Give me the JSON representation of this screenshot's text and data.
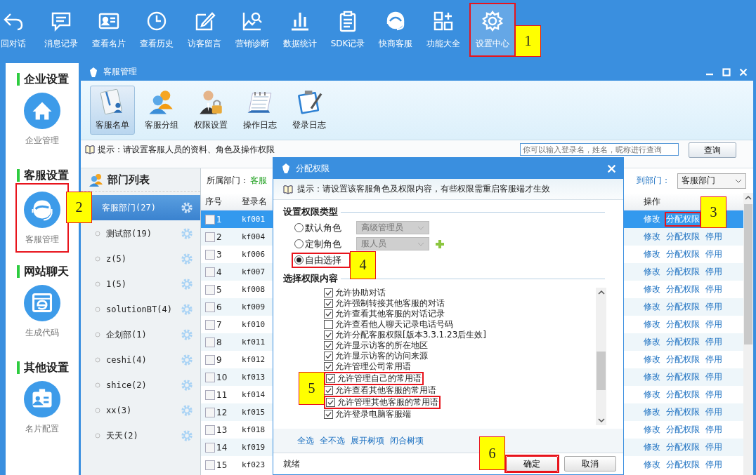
{
  "toolbar": {
    "items": [
      {
        "label": "回对话",
        "selected": false
      },
      {
        "label": "消息记录",
        "selected": false
      },
      {
        "label": "查看名片",
        "selected": false
      },
      {
        "label": "查看历史",
        "selected": false
      },
      {
        "label": "访客留言",
        "selected": false
      },
      {
        "label": "营销诊断",
        "selected": false
      },
      {
        "label": "数据统计",
        "selected": false
      },
      {
        "label": "SDK记录",
        "selected": false
      },
      {
        "label": "快商客服",
        "selected": false
      },
      {
        "label": "功能大全",
        "selected": false
      },
      {
        "label": "设置中心",
        "selected": true
      }
    ]
  },
  "sidebar": {
    "sections": [
      {
        "title": "企业设置",
        "label": "企业管理"
      },
      {
        "title": "客服设置",
        "label": "客服管理"
      },
      {
        "title": "网站聊天",
        "label": "生成代码"
      },
      {
        "title": "其他设置",
        "label": "名片配置"
      }
    ]
  },
  "window": {
    "title": "客服管理",
    "tabs": [
      {
        "label": "客服名单",
        "selected": true
      },
      {
        "label": "客服分组",
        "selected": false
      },
      {
        "label": "权限设置",
        "selected": false
      },
      {
        "label": "操作日志",
        "selected": false
      },
      {
        "label": "登录日志",
        "selected": false
      }
    ],
    "hint": "提示：请设置客服人员的资料、角色及操作权限",
    "search": {
      "placeholder": "你可以输入登录名，姓名，昵称进行查询"
    },
    "search_button": "查询"
  },
  "departments": {
    "title": "部门列表",
    "items": [
      {
        "label": "客服部门(27)",
        "selected": true
      },
      {
        "label": "测试部(19)",
        "selected": false
      },
      {
        "label": "z(5)",
        "selected": false
      },
      {
        "label": "1(5)",
        "selected": false
      },
      {
        "label": "solutionBT(4)",
        "selected": false
      },
      {
        "label": "企划部(1)",
        "selected": false
      },
      {
        "label": "ceshi(4)",
        "selected": false
      },
      {
        "label": "shice(2)",
        "selected": false
      },
      {
        "label": "xx(3)",
        "selected": false
      },
      {
        "label": "天天(2)",
        "selected": false
      }
    ]
  },
  "table": {
    "filter_label": "所属部门：",
    "filter_value": "客服",
    "move_label": "到部门：",
    "move_value": "客服部门",
    "columns": [
      "序号",
      "登录名",
      "操作"
    ],
    "rows": [
      {
        "index": "1",
        "login": "kf001",
        "checked": false,
        "selected": true,
        "actions": [
          "修改",
          "分配权限"
        ]
      },
      {
        "index": "2",
        "login": "kf004",
        "checked": false,
        "selected": false,
        "actions": [
          "修改",
          "分配权限",
          "停用"
        ]
      },
      {
        "index": "3",
        "login": "kf006",
        "checked": false,
        "selected": false,
        "actions": [
          "修改",
          "分配权限",
          "停用"
        ]
      },
      {
        "index": "4",
        "login": "kf007",
        "checked": false,
        "selected": false,
        "actions": [
          "修改",
          "分配权限",
          "停用"
        ]
      },
      {
        "index": "5",
        "login": "kf008",
        "checked": false,
        "selected": false,
        "actions": [
          "修改",
          "分配权限",
          "停用"
        ]
      },
      {
        "index": "6",
        "login": "kf009",
        "checked": false,
        "selected": false,
        "actions": [
          "修改",
          "分配权限",
          "停用"
        ]
      },
      {
        "index": "7",
        "login": "kf010",
        "checked": false,
        "selected": false,
        "actions": [
          "修改",
          "分配权限",
          "停用"
        ]
      },
      {
        "index": "8",
        "login": "kf011",
        "checked": false,
        "selected": false,
        "actions": [
          "修改",
          "分配权限",
          "停用"
        ]
      },
      {
        "index": "9",
        "login": "kf012",
        "checked": false,
        "selected": false,
        "actions": [
          "修改",
          "分配权限",
          "停用"
        ]
      },
      {
        "index": "10",
        "login": "kf013",
        "checked": false,
        "selected": false,
        "actions": [
          "修改",
          "分配权限",
          "停用"
        ]
      },
      {
        "index": "11",
        "login": "kf014",
        "checked": false,
        "selected": false,
        "actions": [
          "修改",
          "分配权限",
          "停用"
        ]
      },
      {
        "index": "12",
        "login": "kf015",
        "checked": false,
        "selected": false,
        "actions": [
          "修改",
          "分配权限",
          "停用"
        ]
      },
      {
        "index": "13",
        "login": "kf018",
        "checked": false,
        "selected": false,
        "actions": [
          "修改",
          "分配权限",
          "停用"
        ]
      },
      {
        "index": "14",
        "login": "kf019",
        "checked": false,
        "selected": false,
        "actions": [
          "修改",
          "分配权限",
          "停用"
        ]
      },
      {
        "index": "15",
        "login": "kf023",
        "checked": false,
        "selected": false,
        "actions": [
          "修改",
          "分配权限",
          "停用"
        ]
      }
    ]
  },
  "dialog": {
    "title": "分配权限",
    "hint": "提示：请设置该客服角色及权限内容，有些权限需重启客服端才生效",
    "type_heading": "设置权限类型",
    "options": [
      {
        "label": "默认角色",
        "selected": false,
        "select": "高级管理员",
        "disabled": true
      },
      {
        "label": "定制角色",
        "selected": false,
        "select": "服人员",
        "disabled": true,
        "add_button": true
      },
      {
        "label": "自由选择",
        "selected": true
      }
    ],
    "content_heading": "选择权限内容",
    "permissions": [
      {
        "label": "允许协助对话",
        "checked": true
      },
      {
        "label": "允许强制转接其他客服的对话",
        "checked": true
      },
      {
        "label": "允许查看其他客服的对话记录",
        "checked": true
      },
      {
        "label": "允许查看他人聊天记录电话号码",
        "checked": false
      },
      {
        "label": "允许分配客服权限[版本3.3.1.23后生效]",
        "checked": true
      },
      {
        "label": "允许显示访客的所在地区",
        "checked": true
      },
      {
        "label": "允许显示访客的访问来源",
        "checked": true
      },
      {
        "label": "允许管理公司常用语",
        "checked": true
      },
      {
        "label": "允许管理自己的常用语",
        "checked": true
      },
      {
        "label": "允许查看其他客服的常用语",
        "checked": true
      },
      {
        "label": "允许管理其他客服的常用语",
        "checked": true
      },
      {
        "label": "允许登录电脑客服端",
        "checked": true
      }
    ],
    "links": [
      "全选",
      "全不选",
      "展开树项",
      "闭合树项"
    ],
    "status": "就绪",
    "buttons": [
      "确定",
      "取消"
    ]
  },
  "annotations": [
    {
      "number": "1"
    },
    {
      "number": "2"
    },
    {
      "number": "3"
    },
    {
      "number": "4"
    },
    {
      "number": "5"
    },
    {
      "number": "6"
    }
  ]
}
